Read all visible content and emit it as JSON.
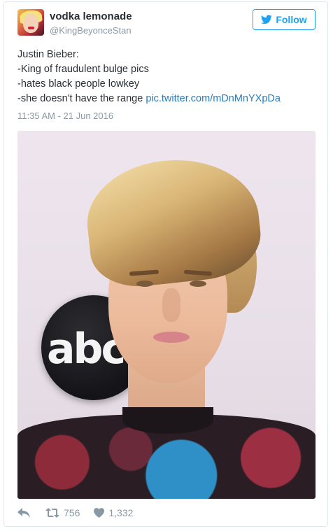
{
  "tweet": {
    "display_name": "vodka lemonade",
    "handle": "@KingBeyonceStan",
    "follow_label": "Follow",
    "text_lines": [
      "Justin Bieber:",
      "-King of fraudulent bulge pics",
      "-hates black people lowkey",
      "-she doesn't have the range "
    ],
    "link": "pic.twitter.com/mDnMnYXpDa",
    "timestamp": "11:35 AM - 21 Jun 2016",
    "photo_logo_text": "abc",
    "retweet_count": "756",
    "like_count": "1,332"
  },
  "icons": {
    "follow": "bird-icon",
    "reply": "reply-icon",
    "retweet": "retweet-icon",
    "like": "heart-icon"
  },
  "colors": {
    "accent": "#1da1f2",
    "link": "#2b7bb9",
    "muted": "#8899a6",
    "text": "#292f33",
    "border": "#e1e8ed"
  }
}
